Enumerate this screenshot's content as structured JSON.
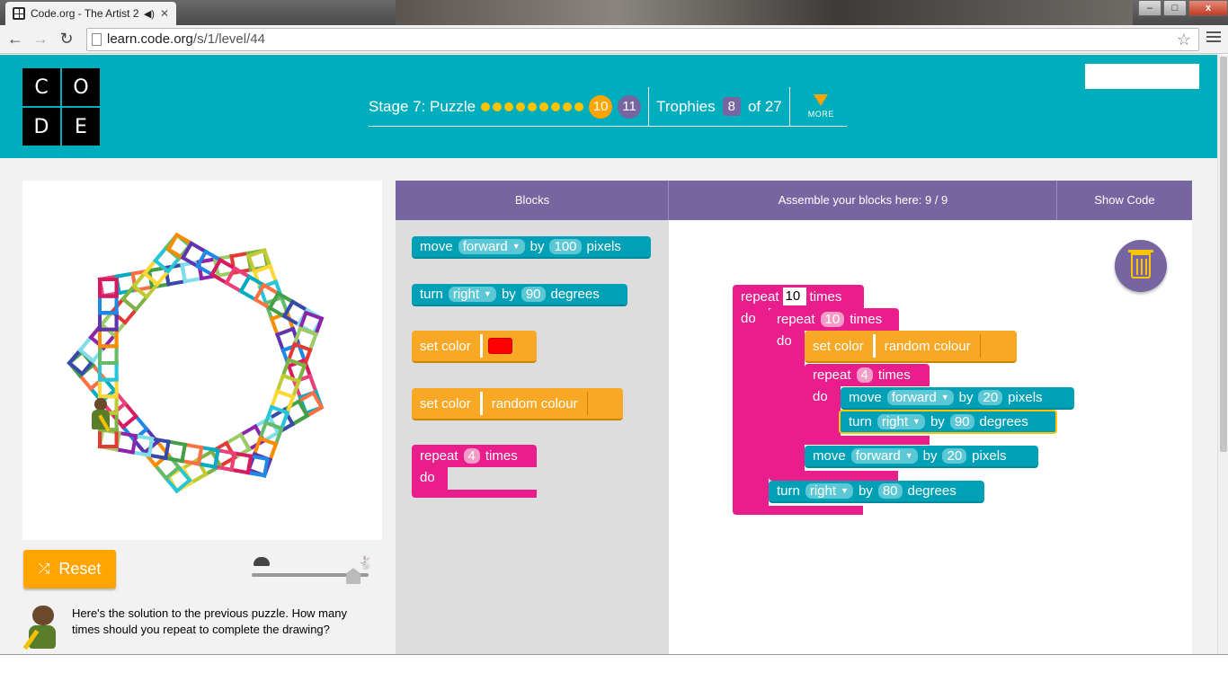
{
  "browser": {
    "tab_title": "Code.org - The Artist 2",
    "tab_audio_icon": "speaker-icon",
    "url_host": "learn.code.org",
    "url_path": "/s/1/level/44",
    "min_label": "–",
    "max_label": "□",
    "close_label": "x"
  },
  "header": {
    "logo_letters": [
      "C",
      "O",
      "D",
      "E"
    ],
    "stage_label": "Stage 7: Puzzle",
    "completed_dots": 9,
    "current_level": "10",
    "next_level": "11",
    "trophies_label": "Trophies",
    "trophies_count": "8",
    "trophies_of": "of 27",
    "more_label": "MORE"
  },
  "controls": {
    "reset_label": "Reset",
    "speed_level": 0.87
  },
  "instructions": {
    "text": "Here's the solution to the previous puzzle. How many times should you repeat to complete the drawing?"
  },
  "workspace_header": {
    "blocks_tab": "Blocks",
    "assemble_label": "Assemble your blocks here: 9 / 9",
    "show_code": "Show Code"
  },
  "toolbox": {
    "move_kw": "move",
    "move_dir": "forward",
    "move_by": "by",
    "move_value": "100",
    "move_unit": "pixels",
    "turn_kw": "turn",
    "turn_dir": "right",
    "turn_by": "by",
    "turn_value": "90",
    "turn_unit": "degrees",
    "setcolor_kw": "set color",
    "setcolor_color": "#ff0000",
    "setcolor2_kw": "set color",
    "random_colour": "random colour",
    "repeat_kw": "repeat",
    "repeat_value": "4",
    "repeat_times": "times",
    "do_kw": "do"
  },
  "program": {
    "outer_repeat_kw": "repeat",
    "outer_repeat_value": "10",
    "outer_times": "times",
    "outer_do": "do",
    "mid_repeat_kw": "repeat",
    "mid_repeat_value": "10",
    "mid_times": "times",
    "mid_do": "do",
    "setcolor_kw": "set color",
    "random_colour": "random colour",
    "inner_repeat_kw": "repeat",
    "inner_repeat_value": "4",
    "inner_times": "times",
    "inner_do": "do",
    "inner_move_kw": "move",
    "inner_move_dir": "forward",
    "inner_move_by": "by",
    "inner_move_value": "20",
    "inner_move_unit": "pixels",
    "inner_turn_kw": "turn",
    "inner_turn_dir": "right",
    "inner_turn_by": "by",
    "inner_turn_value": "90",
    "inner_turn_unit": "degrees",
    "mid_move_kw": "move",
    "mid_move_dir": "forward",
    "mid_move_by": "by",
    "mid_move_value": "20",
    "mid_move_unit": "pixels",
    "outer_turn_kw": "turn",
    "outer_turn_dir": "right",
    "outer_turn_by": "by",
    "outer_turn_value": "80",
    "outer_turn_unit": "degrees"
  }
}
